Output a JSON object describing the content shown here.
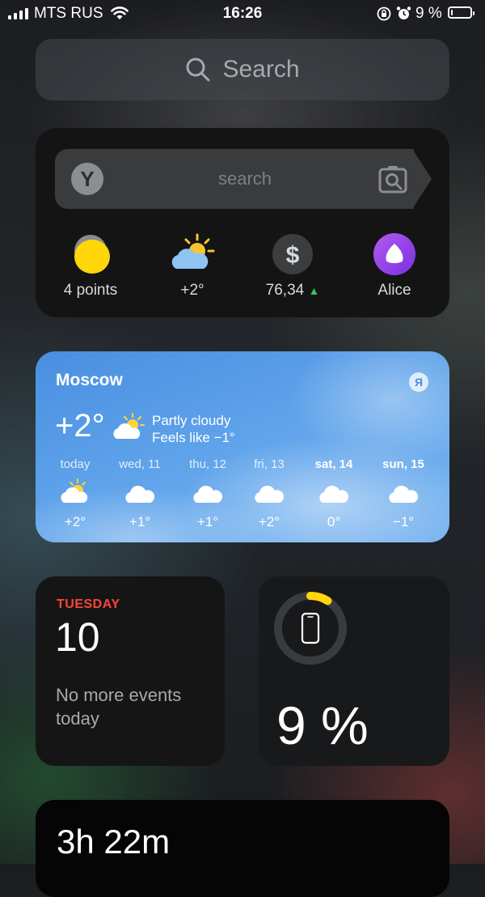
{
  "status_bar": {
    "carrier": "MTS RUS",
    "time": "16:26",
    "battery_text": "9 %",
    "battery_level": 0.09
  },
  "search": {
    "placeholder": "Search"
  },
  "yandex": {
    "logo_letter": "Y",
    "search_placeholder": "search",
    "items": [
      {
        "label": "4 points",
        "icon": "points-coin-icon"
      },
      {
        "label": "+2°",
        "icon": "partly-cloudy-icon"
      },
      {
        "label": "76,34",
        "icon": "dollar-icon",
        "trend": "up",
        "trend_color": "#34c759"
      },
      {
        "label": "Alice",
        "icon": "alice-icon"
      }
    ]
  },
  "weather": {
    "city": "Moscow",
    "badge": "Я",
    "temp": "+2°",
    "condition": "Partly cloudy",
    "feels_like": "Feels like −1°",
    "forecast": [
      {
        "day": "today",
        "temp": "+2°",
        "icon": "partly-cloudy-icon",
        "bold": false
      },
      {
        "day": "wed, 11",
        "temp": "+1°",
        "icon": "cloud-icon",
        "bold": false
      },
      {
        "day": "thu, 12",
        "temp": "+1°",
        "icon": "cloud-icon",
        "bold": false
      },
      {
        "day": "fri, 13",
        "temp": "+2°",
        "icon": "cloud-icon",
        "bold": false
      },
      {
        "day": "sat, 14",
        "temp": "0°",
        "icon": "cloud-icon",
        "bold": true
      },
      {
        "day": "sun, 15",
        "temp": "−1°",
        "icon": "cloud-icon",
        "bold": true
      }
    ]
  },
  "calendar": {
    "weekday": "TUESDAY",
    "date": "10",
    "events_text": "No more events today"
  },
  "battery_widget": {
    "percent_text": "9 %",
    "level": 0.09,
    "ring_color": "#ffd60a"
  },
  "screen_time": {
    "value": "3h 22m"
  }
}
